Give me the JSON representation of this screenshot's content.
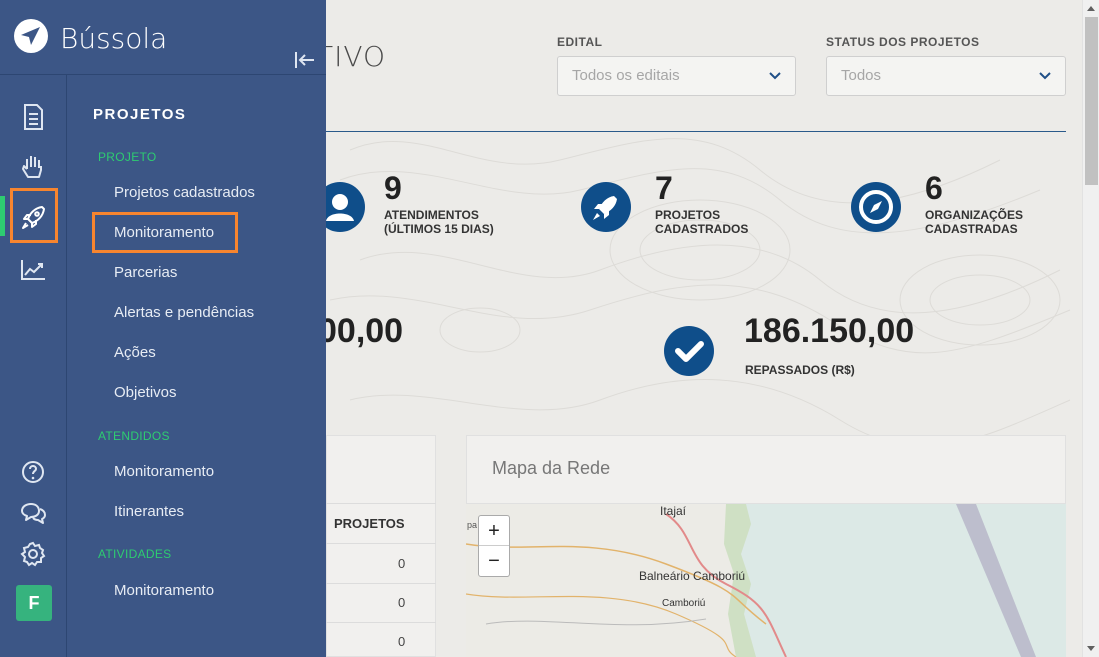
{
  "app": {
    "name": "Bússola"
  },
  "header": {
    "title_fragment": "ATIVO"
  },
  "filters": [
    {
      "label": "EDITAL",
      "value": "Todos os editais"
    },
    {
      "label": "STATUS DOS PROJETOS",
      "value": "Todos"
    }
  ],
  "stats": [
    {
      "number": "9",
      "label_line1": "ATENDIMENTOS",
      "label_line2": "(ÚLTIMOS 15 DIAS)",
      "icon": "user-icon"
    },
    {
      "number": "7",
      "label_line1": "PROJETOS",
      "label_line2": "CADASTRADOS",
      "icon": "rocket-icon"
    },
    {
      "number": "6",
      "label_line1": "ORGANIZAÇÕES",
      "label_line2": "CADASTRADAS",
      "icon": "compass-icon"
    }
  ],
  "totals": [
    {
      "value": "00,00"
    },
    {
      "value": "186.150,00",
      "label": "REPASSADOS (R$)",
      "icon": "check-icon"
    }
  ],
  "table": {
    "header": "PROJETOS",
    "rows": [
      "0",
      "0",
      "0"
    ]
  },
  "map": {
    "title": "Mapa da Rede",
    "zoom_in": "+",
    "zoom_out": "−",
    "places": [
      "Itajaí",
      "Balneário Camboriú",
      "Camboriú",
      "pa"
    ]
  },
  "rail": {
    "icons": [
      "document-icon",
      "hand-icon",
      "rocket-icon",
      "chart-icon",
      "help-icon",
      "chat-icon",
      "gear-icon"
    ],
    "avatar_letter": "F"
  },
  "panel": {
    "title": "PROJETOS",
    "sections": [
      {
        "label": "PROJETO",
        "items": [
          "Projetos cadastrados",
          "Monitoramento",
          "Parcerias",
          "Alertas e pendências",
          "Ações",
          "Objetivos"
        ]
      },
      {
        "label": "ATENDIDOS",
        "items": [
          "Monitoramento",
          "Itinerantes"
        ]
      },
      {
        "label": "ATIVIDADES",
        "items": [
          "Monitoramento"
        ]
      }
    ]
  },
  "colors": {
    "panel": "#3c5686",
    "accent_green": "#2ecc71",
    "highlight": "#f7852f",
    "stat_icon": "#0f4e8a"
  }
}
